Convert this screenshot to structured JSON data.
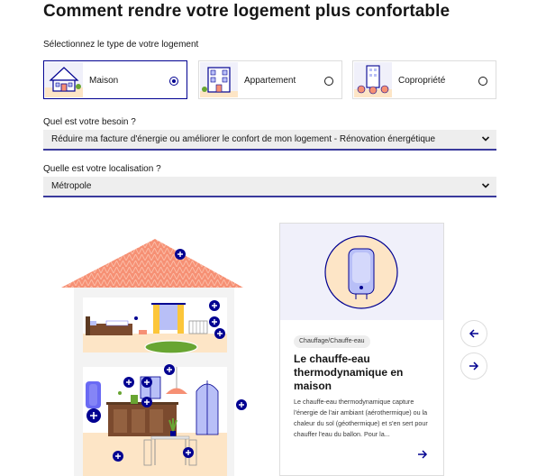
{
  "page": {
    "title": "Comment rendre votre logement plus confortable"
  },
  "housing_type": {
    "label": "Sélectionnez le type de votre logement",
    "options": [
      {
        "label": "Maison",
        "selected": true
      },
      {
        "label": "Appartement",
        "selected": false
      },
      {
        "label": "Copropriété",
        "selected": false
      }
    ]
  },
  "need": {
    "label": "Quel est votre besoin ?",
    "value": "Réduire ma facture d'énergie ou améliorer le confort de mon logement - Rénovation énergétique"
  },
  "location": {
    "label": "Quelle est votre localisation ?",
    "value": "Métropole"
  },
  "card": {
    "tag": "Chauffage/Chauffe-eau",
    "title": "Le chauffe-eau thermodynamique en maison",
    "description": "Le chauffe-eau thermodynamique capture l'énergie de l'air ambiant (aérothermique) ou la chaleur du sol (géothermique) et s'en sert pour chauffer l'eau du ballon. Pour la..."
  },
  "colors": {
    "accent": "#000091",
    "roof": "#f69074",
    "wall": "#ffffff",
    "floor": "#fde5c6",
    "card_media": "#f0f0fa"
  },
  "icons": {
    "hotspot": "plus-circle-icon",
    "previous": "arrow-left-icon",
    "next": "arrow-right-icon",
    "dropdown": "chevron-down-icon"
  }
}
